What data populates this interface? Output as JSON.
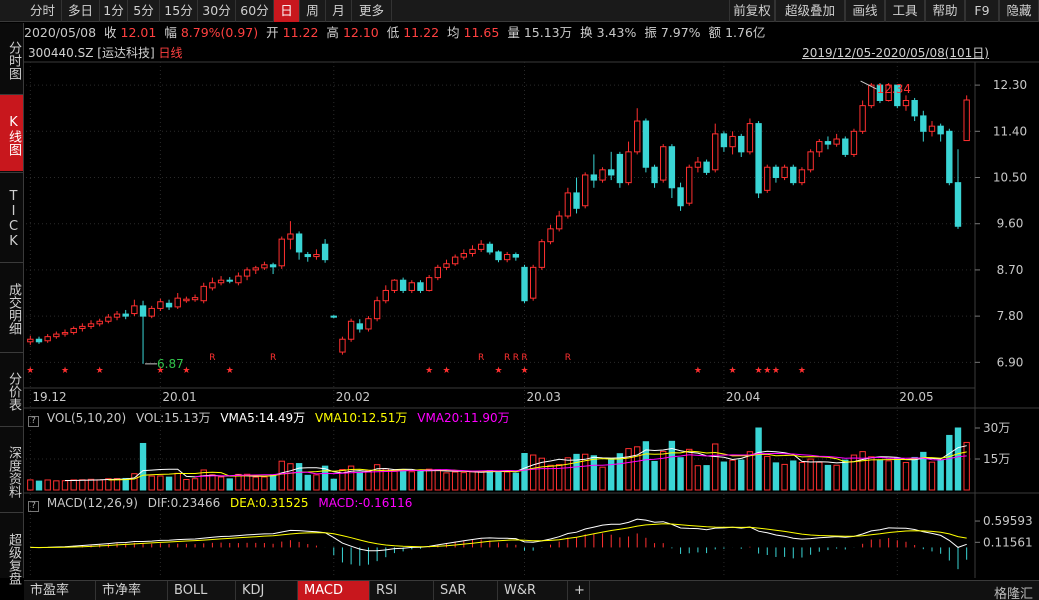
{
  "toolbar": {
    "periods": [
      "分时",
      "多日",
      "1分",
      "5分",
      "15分",
      "30分",
      "60分",
      "日",
      "周",
      "月",
      "更多"
    ],
    "active_period": "日",
    "right_items": [
      "前复权",
      "超级叠加",
      "画线",
      "工具",
      "帮助",
      "F9",
      "隐藏"
    ]
  },
  "info": {
    "date": "2020/05/08",
    "close_label": "收",
    "close": "12.01",
    "change_label": "幅",
    "change": "8.79%(0.97)",
    "open_label": "开",
    "open": "11.22",
    "high_label": "高",
    "high": "12.10",
    "low_label": "低",
    "low": "11.22",
    "avg_label": "均",
    "avg": "11.65",
    "vol_label": "量",
    "vol": "15.13万",
    "turnover_label": "换",
    "turnover": "3.43%",
    "amplitude_label": "振",
    "amplitude": "7.97%",
    "amount_label": "额",
    "amount": "1.76亿"
  },
  "stock": {
    "code": "300440.SZ",
    "name": "[运达科技]",
    "period": "日线"
  },
  "range_text": "2019/12/05-2020/05/08(101日)",
  "sidebar": [
    "分时图",
    "K线图",
    "TICK",
    "成交明细",
    "分价表",
    "深度资料",
    "超级复盘"
  ],
  "sidebar_active": "K线图",
  "vol_panel": {
    "name": "VOL(5,10,20)",
    "vol": "VOL:15.13万",
    "vma5": "VMA5:14.49万",
    "vma10": "VMA10:12.51万",
    "vma20": "VMA20:11.90万",
    "ticks": [
      "30万",
      "15万"
    ]
  },
  "macd_panel": {
    "name": "MACD(12,26,9)",
    "dif": "DIF:0.23466",
    "dea": "DEA:0.31525",
    "macd": "MACD:-0.16116",
    "ticks": [
      "0.59593",
      "0.11561"
    ]
  },
  "bottom_tabs": [
    "市盈率",
    "市净率",
    "BOLL",
    "KDJ",
    "MACD",
    "RSI",
    "SAR",
    "W&R"
  ],
  "bottom_active": "MACD",
  "logo": "格隆汇",
  "colors": {
    "up": "#ff3030",
    "down": "#3ad5d5",
    "ma5": "#ffffff",
    "ma10": "#ffff00",
    "ma20": "#ff00ff",
    "accent": "#c8171d"
  },
  "chart_data": {
    "type": "candlestick",
    "y_ticks": [
      12.3,
      11.4,
      10.5,
      9.6,
      8.7,
      7.8,
      6.9
    ],
    "ylim": [
      6.4,
      12.75
    ],
    "x_ticks": [
      "19.12",
      "20.01",
      "20.02",
      "20.03",
      "20.04",
      "20.05"
    ],
    "annotations": {
      "high": "12.34",
      "low": "6.87"
    },
    "candles": [
      [
        7.3,
        7.35,
        7.24,
        7.42
      ],
      [
        7.35,
        7.3,
        7.26,
        7.4
      ],
      [
        7.32,
        7.4,
        7.28,
        7.45
      ],
      [
        7.4,
        7.45,
        7.36,
        7.5
      ],
      [
        7.45,
        7.48,
        7.4,
        7.54
      ],
      [
        7.48,
        7.56,
        7.44,
        7.6
      ],
      [
        7.56,
        7.6,
        7.5,
        7.66
      ],
      [
        7.6,
        7.65,
        7.55,
        7.72
      ],
      [
        7.65,
        7.7,
        7.6,
        7.75
      ],
      [
        7.7,
        7.78,
        7.66,
        7.84
      ],
      [
        7.78,
        7.84,
        7.72,
        7.9
      ],
      [
        7.84,
        7.8,
        7.74,
        7.92
      ],
      [
        7.85,
        8.0,
        7.8,
        8.12
      ],
      [
        8.0,
        7.8,
        6.87,
        8.1
      ],
      [
        7.8,
        7.95,
        7.76,
        8.0
      ],
      [
        7.95,
        8.08,
        7.9,
        8.14
      ],
      [
        8.05,
        7.98,
        7.92,
        8.12
      ],
      [
        7.98,
        8.15,
        7.94,
        8.25
      ],
      [
        8.1,
        8.13,
        8.06,
        8.18
      ],
      [
        8.12,
        8.16,
        8.08,
        8.22
      ],
      [
        8.1,
        8.38,
        8.05,
        8.45
      ],
      [
        8.35,
        8.45,
        8.3,
        8.55
      ],
      [
        8.45,
        8.5,
        8.4,
        8.58
      ],
      [
        8.5,
        8.48,
        8.44,
        8.56
      ],
      [
        8.45,
        8.58,
        8.4,
        8.65
      ],
      [
        8.58,
        8.7,
        8.5,
        8.75
      ],
      [
        8.7,
        8.74,
        8.62,
        8.78
      ],
      [
        8.74,
        8.8,
        8.7,
        8.86
      ],
      [
        8.8,
        8.76,
        8.62,
        8.84
      ],
      [
        8.78,
        9.3,
        8.72,
        9.35
      ],
      [
        9.3,
        9.4,
        9.1,
        9.65
      ],
      [
        9.4,
        9.05,
        8.9,
        9.45
      ],
      [
        9.0,
        8.96,
        8.86,
        9.05
      ],
      [
        8.96,
        9.0,
        8.9,
        9.1
      ],
      [
        9.2,
        8.9,
        8.84,
        9.3
      ],
      [
        7.8,
        7.78,
        7.76,
        7.82
      ],
      [
        7.1,
        7.35,
        7.05,
        7.4
      ],
      [
        7.35,
        7.7,
        7.3,
        7.75
      ],
      [
        7.65,
        7.55,
        7.48,
        7.74
      ],
      [
        7.55,
        7.75,
        7.5,
        7.8
      ],
      [
        7.75,
        8.1,
        7.7,
        8.18
      ],
      [
        8.1,
        8.3,
        8.05,
        8.4
      ],
      [
        8.3,
        8.5,
        8.25,
        8.52
      ],
      [
        8.5,
        8.3,
        8.25,
        8.55
      ],
      [
        8.3,
        8.45,
        8.25,
        8.5
      ],
      [
        8.45,
        8.3,
        8.25,
        8.5
      ],
      [
        8.3,
        8.55,
        8.28,
        8.6
      ],
      [
        8.55,
        8.75,
        8.5,
        8.8
      ],
      [
        8.75,
        8.82,
        8.7,
        8.9
      ],
      [
        8.82,
        8.95,
        8.78,
        9.0
      ],
      [
        8.95,
        9.02,
        8.9,
        9.1
      ],
      [
        9.02,
        9.1,
        8.96,
        9.18
      ],
      [
        9.1,
        9.2,
        9.05,
        9.28
      ],
      [
        9.2,
        9.05,
        9.0,
        9.25
      ],
      [
        9.05,
        8.9,
        8.85,
        9.08
      ],
      [
        8.9,
        9.0,
        8.85,
        9.05
      ],
      [
        9.0,
        8.95,
        8.88,
        9.04
      ],
      [
        8.75,
        8.1,
        8.05,
        8.8
      ],
      [
        8.15,
        8.75,
        8.1,
        8.8
      ],
      [
        8.75,
        9.25,
        8.7,
        9.3
      ],
      [
        9.25,
        9.5,
        9.2,
        9.58
      ],
      [
        9.5,
        9.75,
        9.45,
        9.85
      ],
      [
        9.75,
        10.2,
        9.7,
        10.3
      ],
      [
        10.2,
        9.9,
        9.8,
        10.5
      ],
      [
        9.95,
        10.55,
        9.9,
        10.6
      ],
      [
        10.55,
        10.45,
        10.3,
        10.95
      ],
      [
        10.45,
        10.65,
        10.4,
        10.7
      ],
      [
        10.65,
        10.55,
        10.45,
        11.0
      ],
      [
        10.95,
        10.4,
        10.3,
        11.0
      ],
      [
        10.4,
        11.0,
        10.35,
        11.2
      ],
      [
        11.0,
        11.6,
        10.95,
        11.85
      ],
      [
        11.6,
        10.7,
        10.6,
        11.65
      ],
      [
        10.7,
        10.4,
        10.3,
        10.75
      ],
      [
        10.45,
        11.1,
        10.4,
        11.15
      ],
      [
        11.1,
        10.3,
        10.1,
        11.15
      ],
      [
        10.3,
        9.95,
        9.85,
        10.4
      ],
      [
        10.0,
        10.7,
        9.95,
        10.75
      ],
      [
        10.7,
        10.8,
        10.6,
        10.9
      ],
      [
        10.8,
        10.6,
        10.55,
        10.85
      ],
      [
        10.65,
        11.35,
        10.6,
        11.55
      ],
      [
        11.35,
        11.1,
        11.0,
        11.4
      ],
      [
        11.1,
        11.3,
        10.95,
        11.4
      ],
      [
        11.3,
        11.0,
        10.9,
        11.35
      ],
      [
        11.0,
        11.55,
        10.95,
        11.65
      ],
      [
        11.55,
        10.2,
        10.1,
        11.6
      ],
      [
        10.25,
        10.7,
        10.2,
        10.75
      ],
      [
        10.7,
        10.5,
        10.4,
        10.75
      ],
      [
        10.5,
        10.7,
        10.45,
        10.75
      ],
      [
        10.7,
        10.4,
        10.35,
        10.75
      ],
      [
        10.4,
        10.65,
        10.35,
        10.7
      ],
      [
        10.65,
        11.0,
        10.6,
        11.05
      ],
      [
        11.0,
        11.2,
        10.9,
        11.25
      ],
      [
        11.2,
        11.15,
        11.05,
        11.3
      ],
      [
        11.15,
        11.25,
        11.1,
        11.35
      ],
      [
        11.25,
        10.95,
        10.9,
        11.3
      ],
      [
        10.95,
        11.4,
        10.9,
        11.45
      ],
      [
        11.4,
        11.9,
        11.35,
        12.0
      ],
      [
        11.9,
        12.3,
        11.85,
        12.34
      ],
      [
        12.3,
        12.0,
        11.95,
        12.34
      ],
      [
        12.0,
        12.3,
        11.98,
        12.34
      ],
      [
        12.3,
        11.9,
        11.85,
        12.3
      ],
      [
        11.9,
        12.0,
        11.8,
        12.1
      ],
      [
        12.0,
        11.7,
        11.6,
        12.05
      ],
      [
        11.7,
        11.4,
        11.2,
        11.8
      ],
      [
        11.4,
        11.5,
        11.3,
        11.6
      ],
      [
        11.5,
        11.35,
        11.2,
        11.55
      ],
      [
        11.4,
        10.4,
        10.35,
        11.45
      ],
      [
        10.4,
        9.55,
        9.5,
        11.05
      ],
      [
        11.22,
        12.01,
        11.22,
        12.1
      ]
    ]
  }
}
